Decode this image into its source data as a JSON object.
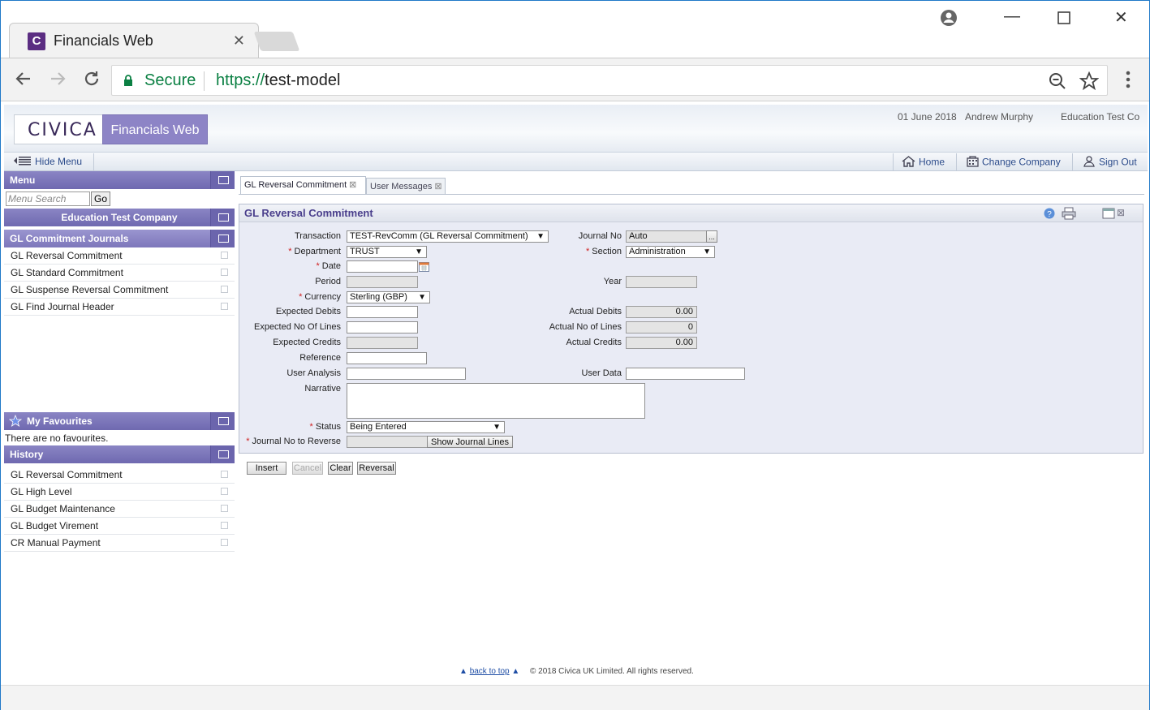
{
  "browser": {
    "tab_title": "Financials Web",
    "secure_label": "Secure",
    "url_scheme": "https://",
    "url_host": "test-model"
  },
  "header": {
    "logo_text": "CIVICA",
    "brand": "Financials Web",
    "date": "01 June 2018",
    "user": "Andrew Murphy",
    "company": "Education Test Co"
  },
  "menubar": {
    "hide_menu": "Hide Menu",
    "home": "Home",
    "change_company": "Change Company",
    "sign_out": "Sign Out"
  },
  "sidebar": {
    "menu_title": "Menu",
    "search_placeholder": "Menu Search",
    "go": "Go",
    "company_title": "Education Test Company",
    "journals_title": "GL Commitment Journals",
    "journal_items": [
      "GL Reversal Commitment",
      "GL Standard Commitment",
      "GL Suspense Reversal Commitment",
      "GL Find Journal Header"
    ],
    "favourites_title": "My Favourites",
    "favourites_empty": "There are no favourites.",
    "history_title": "History",
    "history_items": [
      "GL Reversal Commitment",
      "GL High Level",
      "GL Budget Maintenance",
      "GL Budget Virement",
      "CR Manual Payment"
    ]
  },
  "tabs": [
    "GL Reversal Commitment",
    "User Messages"
  ],
  "form": {
    "title": "GL Reversal Commitment",
    "labels": {
      "transaction": "Transaction",
      "journal_no": "Journal No",
      "department": "Department",
      "section": "Section",
      "date": "Date",
      "period": "Period",
      "year": "Year",
      "currency": "Currency",
      "expected_debits": "Expected Debits",
      "actual_debits": "Actual Debits",
      "expected_lines": "Expected No Of Lines",
      "actual_lines": "Actual No of Lines",
      "expected_credits": "Expected Credits",
      "actual_credits": "Actual Credits",
      "reference": "Reference",
      "user_analysis": "User Analysis",
      "user_data": "User Data",
      "narrative": "Narrative",
      "status": "Status",
      "journal_to_reverse": "Journal No to Reverse"
    },
    "values": {
      "transaction": "TEST-RevComm (GL Reversal Commitment)",
      "journal_no": "Auto",
      "journal_no_btn": "...",
      "department": "TRUST",
      "section": "Administration",
      "currency": "Sterling (GBP)",
      "actual_debits": "0.00",
      "actual_lines": "0",
      "actual_credits": "0.00",
      "status": "Being Entered",
      "show_lines": "Show Journal Lines"
    },
    "buttons": [
      "Insert",
      "Cancel",
      "Clear",
      "Reversal"
    ]
  },
  "footer": {
    "back_to_top": "back to top",
    "copyright": "© 2018 Civica UK Limited. All rights reserved."
  }
}
